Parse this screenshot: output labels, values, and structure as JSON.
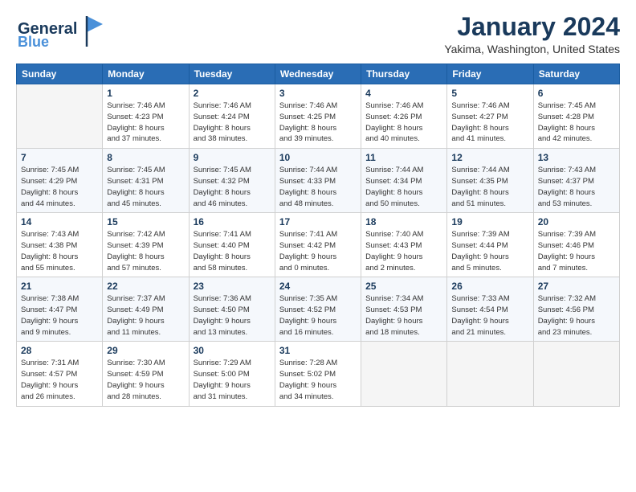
{
  "logo": {
    "general": "General",
    "blue": "Blue",
    "tagline": "Blue"
  },
  "header": {
    "title": "January 2024",
    "subtitle": "Yakima, Washington, United States"
  },
  "weekdays": [
    "Sunday",
    "Monday",
    "Tuesday",
    "Wednesday",
    "Thursday",
    "Friday",
    "Saturday"
  ],
  "weeks": [
    [
      {
        "day": "",
        "sunrise": "",
        "sunset": "",
        "daylight": ""
      },
      {
        "day": "1",
        "sunrise": "Sunrise: 7:46 AM",
        "sunset": "Sunset: 4:23 PM",
        "daylight": "Daylight: 8 hours and 37 minutes."
      },
      {
        "day": "2",
        "sunrise": "Sunrise: 7:46 AM",
        "sunset": "Sunset: 4:24 PM",
        "daylight": "Daylight: 8 hours and 38 minutes."
      },
      {
        "day": "3",
        "sunrise": "Sunrise: 7:46 AM",
        "sunset": "Sunset: 4:25 PM",
        "daylight": "Daylight: 8 hours and 39 minutes."
      },
      {
        "day": "4",
        "sunrise": "Sunrise: 7:46 AM",
        "sunset": "Sunset: 4:26 PM",
        "daylight": "Daylight: 8 hours and 40 minutes."
      },
      {
        "day": "5",
        "sunrise": "Sunrise: 7:46 AM",
        "sunset": "Sunset: 4:27 PM",
        "daylight": "Daylight: 8 hours and 41 minutes."
      },
      {
        "day": "6",
        "sunrise": "Sunrise: 7:45 AM",
        "sunset": "Sunset: 4:28 PM",
        "daylight": "Daylight: 8 hours and 42 minutes."
      }
    ],
    [
      {
        "day": "7",
        "sunrise": "Sunrise: 7:45 AM",
        "sunset": "Sunset: 4:29 PM",
        "daylight": "Daylight: 8 hours and 44 minutes."
      },
      {
        "day": "8",
        "sunrise": "Sunrise: 7:45 AM",
        "sunset": "Sunset: 4:31 PM",
        "daylight": "Daylight: 8 hours and 45 minutes."
      },
      {
        "day": "9",
        "sunrise": "Sunrise: 7:45 AM",
        "sunset": "Sunset: 4:32 PM",
        "daylight": "Daylight: 8 hours and 46 minutes."
      },
      {
        "day": "10",
        "sunrise": "Sunrise: 7:44 AM",
        "sunset": "Sunset: 4:33 PM",
        "daylight": "Daylight: 8 hours and 48 minutes."
      },
      {
        "day": "11",
        "sunrise": "Sunrise: 7:44 AM",
        "sunset": "Sunset: 4:34 PM",
        "daylight": "Daylight: 8 hours and 50 minutes."
      },
      {
        "day": "12",
        "sunrise": "Sunrise: 7:44 AM",
        "sunset": "Sunset: 4:35 PM",
        "daylight": "Daylight: 8 hours and 51 minutes."
      },
      {
        "day": "13",
        "sunrise": "Sunrise: 7:43 AM",
        "sunset": "Sunset: 4:37 PM",
        "daylight": "Daylight: 8 hours and 53 minutes."
      }
    ],
    [
      {
        "day": "14",
        "sunrise": "Sunrise: 7:43 AM",
        "sunset": "Sunset: 4:38 PM",
        "daylight": "Daylight: 8 hours and 55 minutes."
      },
      {
        "day": "15",
        "sunrise": "Sunrise: 7:42 AM",
        "sunset": "Sunset: 4:39 PM",
        "daylight": "Daylight: 8 hours and 57 minutes."
      },
      {
        "day": "16",
        "sunrise": "Sunrise: 7:41 AM",
        "sunset": "Sunset: 4:40 PM",
        "daylight": "Daylight: 8 hours and 58 minutes."
      },
      {
        "day": "17",
        "sunrise": "Sunrise: 7:41 AM",
        "sunset": "Sunset: 4:42 PM",
        "daylight": "Daylight: 9 hours and 0 minutes."
      },
      {
        "day": "18",
        "sunrise": "Sunrise: 7:40 AM",
        "sunset": "Sunset: 4:43 PM",
        "daylight": "Daylight: 9 hours and 2 minutes."
      },
      {
        "day": "19",
        "sunrise": "Sunrise: 7:39 AM",
        "sunset": "Sunset: 4:44 PM",
        "daylight": "Daylight: 9 hours and 5 minutes."
      },
      {
        "day": "20",
        "sunrise": "Sunrise: 7:39 AM",
        "sunset": "Sunset: 4:46 PM",
        "daylight": "Daylight: 9 hours and 7 minutes."
      }
    ],
    [
      {
        "day": "21",
        "sunrise": "Sunrise: 7:38 AM",
        "sunset": "Sunset: 4:47 PM",
        "daylight": "Daylight: 9 hours and 9 minutes."
      },
      {
        "day": "22",
        "sunrise": "Sunrise: 7:37 AM",
        "sunset": "Sunset: 4:49 PM",
        "daylight": "Daylight: 9 hours and 11 minutes."
      },
      {
        "day": "23",
        "sunrise": "Sunrise: 7:36 AM",
        "sunset": "Sunset: 4:50 PM",
        "daylight": "Daylight: 9 hours and 13 minutes."
      },
      {
        "day": "24",
        "sunrise": "Sunrise: 7:35 AM",
        "sunset": "Sunset: 4:52 PM",
        "daylight": "Daylight: 9 hours and 16 minutes."
      },
      {
        "day": "25",
        "sunrise": "Sunrise: 7:34 AM",
        "sunset": "Sunset: 4:53 PM",
        "daylight": "Daylight: 9 hours and 18 minutes."
      },
      {
        "day": "26",
        "sunrise": "Sunrise: 7:33 AM",
        "sunset": "Sunset: 4:54 PM",
        "daylight": "Daylight: 9 hours and 21 minutes."
      },
      {
        "day": "27",
        "sunrise": "Sunrise: 7:32 AM",
        "sunset": "Sunset: 4:56 PM",
        "daylight": "Daylight: 9 hours and 23 minutes."
      }
    ],
    [
      {
        "day": "28",
        "sunrise": "Sunrise: 7:31 AM",
        "sunset": "Sunset: 4:57 PM",
        "daylight": "Daylight: 9 hours and 26 minutes."
      },
      {
        "day": "29",
        "sunrise": "Sunrise: 7:30 AM",
        "sunset": "Sunset: 4:59 PM",
        "daylight": "Daylight: 9 hours and 28 minutes."
      },
      {
        "day": "30",
        "sunrise": "Sunrise: 7:29 AM",
        "sunset": "Sunset: 5:00 PM",
        "daylight": "Daylight: 9 hours and 31 minutes."
      },
      {
        "day": "31",
        "sunrise": "Sunrise: 7:28 AM",
        "sunset": "Sunset: 5:02 PM",
        "daylight": "Daylight: 9 hours and 34 minutes."
      },
      {
        "day": "",
        "sunrise": "",
        "sunset": "",
        "daylight": ""
      },
      {
        "day": "",
        "sunrise": "",
        "sunset": "",
        "daylight": ""
      },
      {
        "day": "",
        "sunrise": "",
        "sunset": "",
        "daylight": ""
      }
    ]
  ]
}
